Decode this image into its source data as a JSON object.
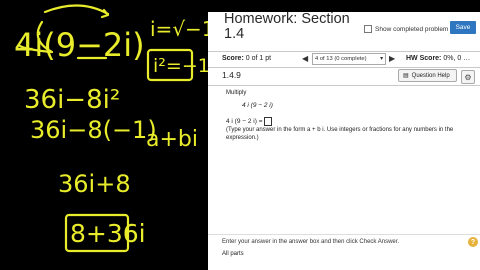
{
  "whiteboard": {
    "line1": "4i(9−2i)",
    "line2": "36i−8i²",
    "line3": "36i−8(−1)",
    "line4": "36i+8",
    "answer": "8+36i",
    "note_i": "i=√−1",
    "note_i2": "i²=−1",
    "note_form": "a+bi",
    "ink_color": "#e8ec2a"
  },
  "header": {
    "title": "Homework: Section 1.4",
    "show_completed_label": "Show completed problem",
    "save_label": "Save"
  },
  "score_bar": {
    "score_label": "Score:",
    "score_value": "0 of 1 pt",
    "question_selector": "4 of 13 (0 complete)",
    "hw_score_label": "HW Score:",
    "hw_score_value": "0%, 0 …"
  },
  "question_bar": {
    "number": "1.4.9",
    "help_label": "Question Help"
  },
  "problem": {
    "instruction": "Multiply",
    "expression": "4 i (9 − 2 i)",
    "answer_prefix": "4 i (9 − 2 i) =",
    "answer_value": "",
    "type_instructions": "(Type your answer in the form a + b i. Use integers or fractions for any numbers in the expression.)"
  },
  "footer": {
    "text": "Enter your answer in the answer box and then click Check Answer.",
    "points": "All parts"
  },
  "colors": {
    "save_button": "#2f76c0",
    "help_icon": "#e8b13a"
  }
}
